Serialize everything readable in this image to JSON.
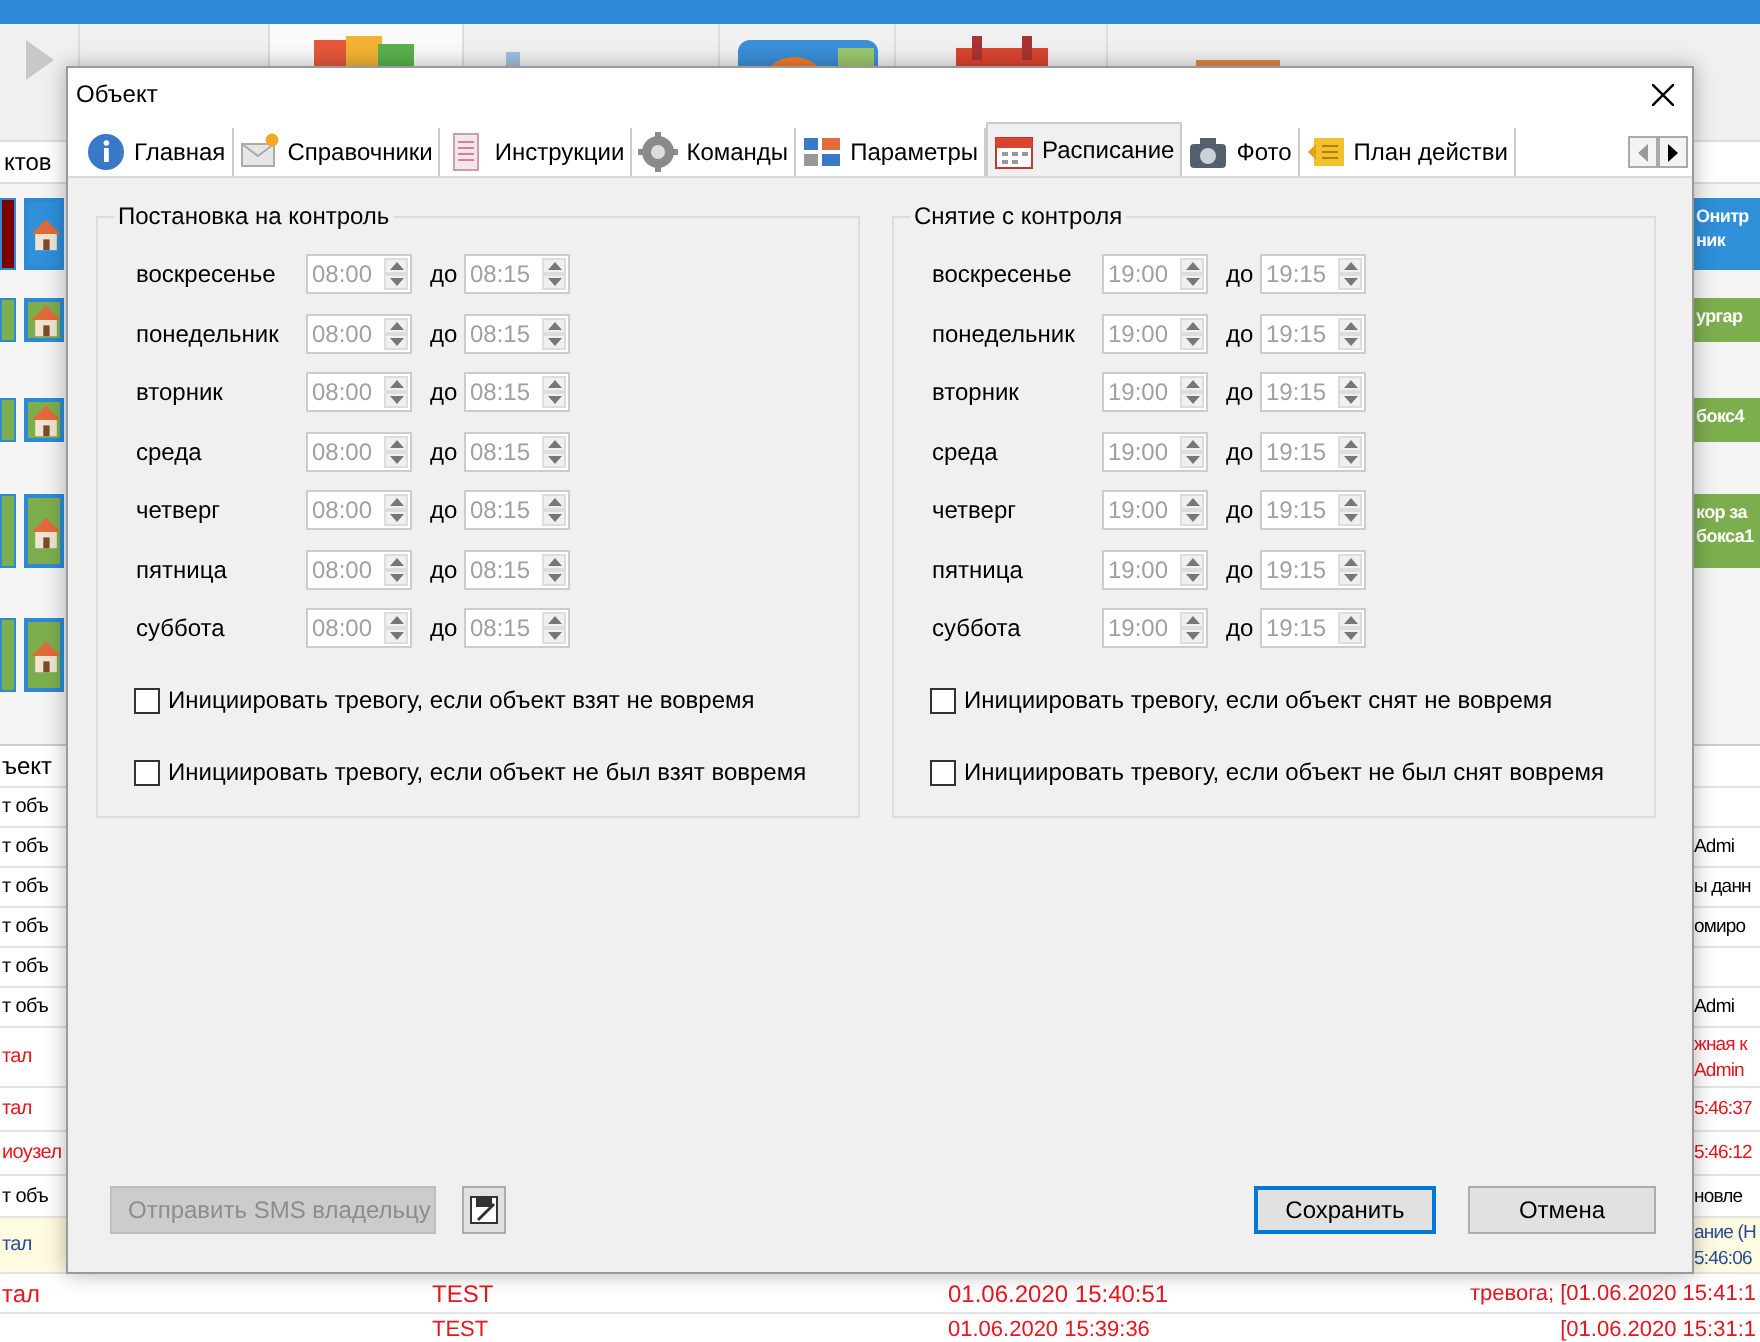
{
  "background": {
    "strip_label": "ктов",
    "tiles": [
      {
        "marker": {
          "color": "#7a0000"
        },
        "color": "#2f8fd8",
        "lines": [
          "Онитр",
          "ник"
        ]
      },
      {
        "marker": {
          "color": "#7cae4e"
        },
        "color": "#7cae4e",
        "lines": [
          "ургар"
        ]
      },
      {
        "marker": {
          "color": "#7cae4e"
        },
        "color": "#7cae4e",
        "lines": [
          "бокс4"
        ]
      },
      {
        "marker": {
          "color": "#7cae4e"
        },
        "color": "#7cae4e",
        "lines": [
          "кор за",
          "бокса1"
        ]
      },
      {
        "marker": {
          "color": "#7cae4e"
        },
        "color": "#7cae4e"
      }
    ],
    "rows": [
      {
        "kind": "header",
        "left": "ъект",
        "color": "#000000",
        "highlight": false
      },
      {
        "kind": "edge",
        "left": "т объ",
        "color": "#000000",
        "highlight": false
      },
      {
        "kind": "edge",
        "left": "т объ",
        "right": [
          "Admi"
        ],
        "color": "#000000",
        "highlight": false
      },
      {
        "kind": "edge",
        "left": "т объ",
        "right": [
          "ы данн"
        ],
        "color": "#000000",
        "highlight": false
      },
      {
        "kind": "edge",
        "left": "т объ",
        "right": [
          "омиро"
        ],
        "color": "#000000",
        "highlight": false
      },
      {
        "kind": "edge",
        "left": "т объ",
        "color": "#000000",
        "highlight": false
      },
      {
        "kind": "edge",
        "left": "т объ",
        "right": [
          "Admi"
        ],
        "color": "#000000",
        "highlight": false
      },
      {
        "kind": "edge",
        "left": "тал",
        "right": [
          "жная к",
          "Admin"
        ],
        "color": "#e8141e",
        "highlight": false
      },
      {
        "kind": "edge",
        "left": "тал",
        "right": [
          "5:46:37"
        ],
        "color": "#e8141e",
        "highlight": false
      },
      {
        "kind": "edge",
        "left": "иоузел",
        "right": [
          "5:46:12"
        ],
        "color": "#e8141e",
        "highlight": false
      },
      {
        "kind": "edge",
        "left": "т объ",
        "right": [
          "новле"
        ],
        "color": "#000000",
        "highlight": false
      },
      {
        "kind": "edge",
        "left": "тал",
        "right": [
          "ание (Н",
          "5:46:06"
        ],
        "color": "#2a4d9b",
        "highlight": true
      },
      {
        "kind": "full",
        "column_1": "тал",
        "column_2": "TEST",
        "column_3": "01.06.2020 15:40:51",
        "column_4": "тревога; [01.06.2020 15:41:1",
        "color": "#e8141e",
        "highlight": false
      },
      {
        "kind": "full",
        "column_2": "TEST",
        "column_3": "01.06.2020 15:39:36",
        "column_4": "[01.06.2020 15:31:1",
        "color": "#e8141e",
        "highlight": false
      }
    ]
  },
  "window": {
    "title": "Объект"
  },
  "tabs": [
    {
      "label": "Главная",
      "selected": false
    },
    {
      "label": "Справочники",
      "selected": false
    },
    {
      "label": "Инструкции",
      "selected": false
    },
    {
      "label": "Команды",
      "selected": false
    },
    {
      "label": "Параметры",
      "selected": false
    },
    {
      "label": "Расписание",
      "selected": true
    },
    {
      "label": "Фото",
      "selected": false
    },
    {
      "label": "План действи",
      "selected": false
    }
  ],
  "groups": [
    {
      "title": "Постановка на контроль",
      "inputs_disabled": true,
      "rows": [
        {
          "day": "воскресенье",
          "from": "08:00",
          "sep": "до",
          "to": "08:15"
        },
        {
          "day": "понедельник",
          "from": "08:00",
          "sep": "до",
          "to": "08:15"
        },
        {
          "day": "вторник",
          "from": "08:00",
          "sep": "до",
          "to": "08:15"
        },
        {
          "day": "среда",
          "from": "08:00",
          "sep": "до",
          "to": "08:15"
        },
        {
          "day": "четверг",
          "from": "08:00",
          "sep": "до",
          "to": "08:15"
        },
        {
          "day": "пятница",
          "from": "08:00",
          "sep": "до",
          "to": "08:15"
        },
        {
          "day": "суббота",
          "from": "08:00",
          "sep": "до",
          "to": "08:15"
        }
      ],
      "checkboxes": [
        {
          "label": "Инициировать тревогу, если объект взят не вовремя",
          "checked": false
        },
        {
          "label": "Инициировать тревогу, если объект не был взят вовремя",
          "checked": false
        }
      ]
    },
    {
      "title": "Снятие с контроля",
      "inputs_disabled": true,
      "rows": [
        {
          "day": "воскресенье",
          "from": "19:00",
          "sep": "до",
          "to": "19:15"
        },
        {
          "day": "понедельник",
          "from": "19:00",
          "sep": "до",
          "to": "19:15"
        },
        {
          "day": "вторник",
          "from": "19:00",
          "sep": "до",
          "to": "19:15"
        },
        {
          "day": "среда",
          "from": "19:00",
          "sep": "до",
          "to": "19:15"
        },
        {
          "day": "четверг",
          "from": "19:00",
          "sep": "до",
          "to": "19:15"
        },
        {
          "day": "пятница",
          "from": "19:00",
          "sep": "до",
          "to": "19:15"
        },
        {
          "day": "суббота",
          "from": "19:00",
          "sep": "до",
          "to": "19:15"
        }
      ],
      "checkboxes": [
        {
          "label": "Инициировать тревогу, если объект снят не вовремя",
          "checked": false
        },
        {
          "label": "Инициировать тревогу, если объект не был снят вовремя",
          "checked": false
        }
      ]
    }
  ],
  "sms_button": {
    "label": "Отправить SMS владельцу",
    "disabled": true
  },
  "save_button": {
    "label": "Сохранить",
    "default": true
  },
  "cancel_button": {
    "label": "Отмена"
  }
}
